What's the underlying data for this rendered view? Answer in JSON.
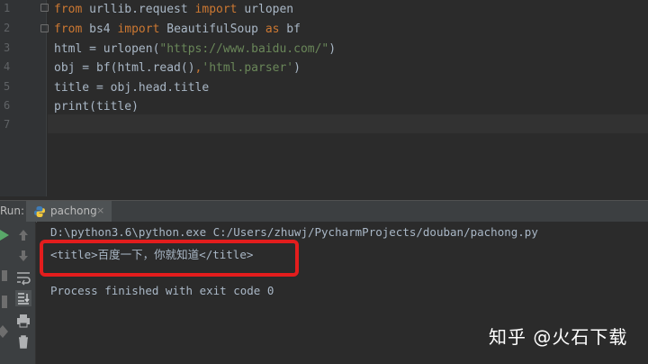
{
  "editor": {
    "line_numbers": [
      "1",
      "2",
      "3",
      "4",
      "5",
      "6",
      "7"
    ],
    "lines": [
      [
        {
          "t": "from",
          "c": "kw"
        },
        {
          "t": " urllib.request "
        },
        {
          "t": "import",
          "c": "kw"
        },
        {
          "t": " urlopen"
        }
      ],
      [
        {
          "t": "from",
          "c": "kw"
        },
        {
          "t": " bs4 "
        },
        {
          "t": "import",
          "c": "kw"
        },
        {
          "t": " BeautifulSoup "
        },
        {
          "t": "as",
          "c": "kw"
        },
        {
          "t": " bf"
        }
      ],
      [
        {
          "t": "html = urlopen("
        },
        {
          "t": "\"https://www.baidu.com/\"",
          "c": "str"
        },
        {
          "t": ")"
        }
      ],
      [
        {
          "t": "obj = bf(html.read()"
        },
        {
          "t": ",",
          "c": "kw"
        },
        {
          "t": "'html.parser'",
          "c": "str"
        },
        {
          "t": ")"
        }
      ],
      [
        {
          "t": "title = obj.head.title"
        }
      ],
      [
        {
          "t": "print(title)"
        }
      ],
      []
    ]
  },
  "run": {
    "label": "Run:",
    "tab_label": "pachong",
    "tab_close": "×",
    "toolbar_icons": [
      "run-icon",
      "up-arrow-icon",
      "down-arrow-icon",
      "stop-icon",
      "soft-wrap-icon",
      "scroll-to-end-icon",
      "print-icon",
      "pin-icon",
      "delete-icon"
    ]
  },
  "console": {
    "command": "D:\\python3.6\\python.exe C:/Users/zhuwj/PycharmProjects/douban/pachong.py",
    "output": "<title>百度一下，你就知道</title>",
    "exit": "Process finished with exit code 0"
  },
  "watermark": "知乎 @火石下载",
  "colors": {
    "background": "#2b2b2b",
    "keyword": "#cc7832",
    "string": "#6a8759",
    "text": "#a9b7c6",
    "highlight": "#e31d1d"
  }
}
